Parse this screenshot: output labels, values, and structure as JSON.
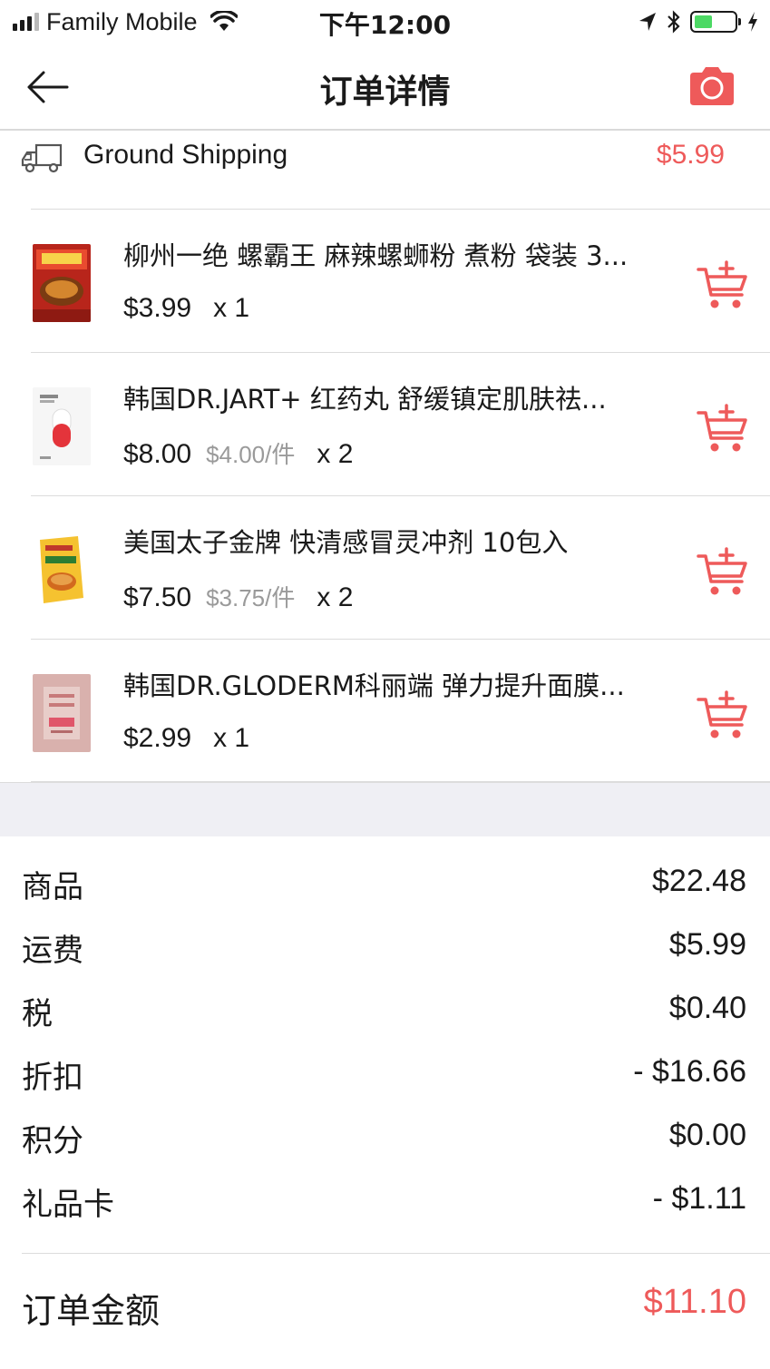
{
  "status_bar": {
    "carrier": "Family Mobile",
    "time": "下午12:00",
    "battery_color": "#4cd964"
  },
  "nav": {
    "title": "订单详情",
    "back_icon": "arrow-left-icon",
    "camera_icon": "camera-icon"
  },
  "shipping": {
    "icon": "truck-icon",
    "label": "Ground Shipping",
    "price": "$5.99"
  },
  "products": [
    {
      "name": "柳州一绝 螺霸王 麻辣螺蛳粉 煮粉 袋装 3...",
      "price": "$3.99",
      "unit_price": "",
      "qty": "x 1"
    },
    {
      "name": "韩国DR.JART+ 红药丸 舒缓镇定肌肤祛...",
      "price": "$8.00",
      "unit_price": "$4.00/件",
      "qty": "x 2"
    },
    {
      "name": "美国太子金牌 快清感冒灵冲剂 10包入",
      "price": "$7.50",
      "unit_price": "$3.75/件",
      "qty": "x 2"
    },
    {
      "name": "韩国DR.GLODERM科丽端 弹力提升面膜...",
      "price": "$2.99",
      "unit_price": "",
      "qty": "x 1"
    }
  ],
  "summary": [
    {
      "label": "商品",
      "value": "$22.48"
    },
    {
      "label": "运费",
      "value": "$5.99"
    },
    {
      "label": "税",
      "value": "$0.40"
    },
    {
      "label": "折扣",
      "value": "- $16.66"
    },
    {
      "label": "积分",
      "value": "$0.00"
    },
    {
      "label": "礼品卡",
      "value": "- $1.11"
    }
  ],
  "total": {
    "label": "订单金额",
    "value": "$11.10"
  },
  "colors": {
    "accent": "#ee5a5a",
    "muted": "#9a9a9a",
    "band": "#efeff4"
  }
}
